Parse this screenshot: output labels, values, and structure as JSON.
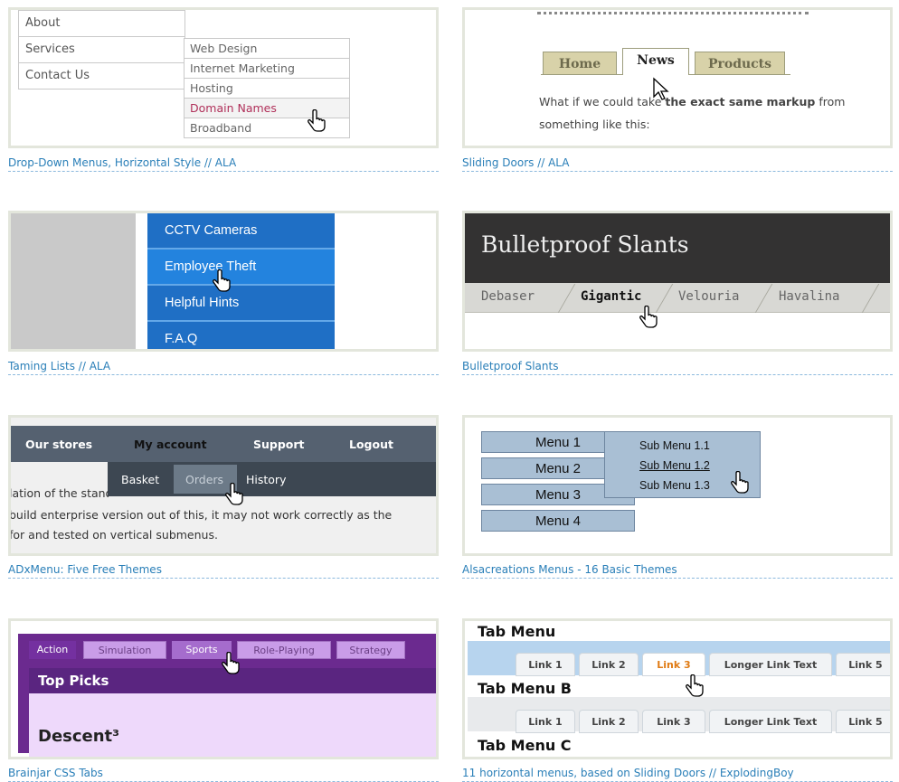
{
  "cards": {
    "dropdown": {
      "caption": "Drop-Down Menus, Horizontal Style // ALA",
      "main_items": [
        "About",
        "Services",
        "Contact Us"
      ],
      "sub_items": [
        "Web Design",
        "Internet Marketing",
        "Hosting",
        "Domain Names",
        "Broadband"
      ]
    },
    "sliding": {
      "caption": "Sliding Doors // ALA",
      "tabs": [
        "Home",
        "News",
        "Products"
      ],
      "text_line1_a": "What if we could take ",
      "text_line1_b": "the exact same markup",
      "text_line1_c": " from",
      "text_line2": "something like this:"
    },
    "taming": {
      "caption": "Taming Lists // ALA",
      "items": [
        "CCTV Cameras",
        "Employee Theft",
        "Helpful Hints",
        "F.A.Q"
      ]
    },
    "slants": {
      "caption": "Bulletproof Slants",
      "title": "Bulletproof Slants",
      "tabs": [
        "Debaser",
        "Gigantic",
        "Velouria",
        "Havalina"
      ]
    },
    "adx": {
      "caption": "ADxMenu: Five Free Themes",
      "top_items": [
        "Our stores",
        "My account",
        "Support",
        "Logout"
      ],
      "sub_items": [
        "Basket",
        "Orders",
        "History"
      ],
      "text_line1": "lation of the standard menu, demonstrated here with some custom",
      "text_line2": "build enterprise version out of this, it may not work correctly as the",
      "text_line3": "for and tested on vertical submenus."
    },
    "alsa": {
      "caption": "Alsacreations Menus - 16 Basic Themes",
      "items": [
        "Menu 1",
        "Menu 2",
        "Menu 3",
        "Menu 4"
      ],
      "sub_items": [
        "Sub Menu 1.1",
        "Sub Menu 1.2",
        "Sub Menu 1.3"
      ]
    },
    "brainjar": {
      "caption": "Brainjar CSS Tabs",
      "tabs": [
        "Action",
        "Simulation",
        "Sports",
        "Role-Playing",
        "Strategy"
      ],
      "heading": "Top Picks",
      "content": "Descent³"
    },
    "horizontal": {
      "caption": "11 horizontal menus, based on Sliding Doors // ExplodingBoy",
      "heading_a": "Tab Menu",
      "heading_b": "Tab Menu B",
      "heading_c": "Tab Menu C",
      "tabs": [
        "Link 1",
        "Link 2",
        "Link 3",
        "Longer Link Text",
        "Link 5"
      ]
    }
  }
}
